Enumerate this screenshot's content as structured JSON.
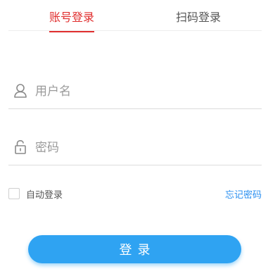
{
  "tabs": [
    {
      "label": "账号登录",
      "active": true
    },
    {
      "label": "扫码登录",
      "active": false
    }
  ],
  "form": {
    "username": {
      "placeholder": "用户名",
      "value": "",
      "icon": "user-icon"
    },
    "password": {
      "placeholder": "密码",
      "value": "",
      "icon": "lock-icon"
    }
  },
  "remember": {
    "label": "自动登录",
    "checked": false
  },
  "forgot_label": "忘记密码",
  "login_label": "登录",
  "colors": {
    "accent_red": "#e02e2e",
    "link_blue": "#2a8ff0",
    "button_blue": "#2fa3f2"
  }
}
